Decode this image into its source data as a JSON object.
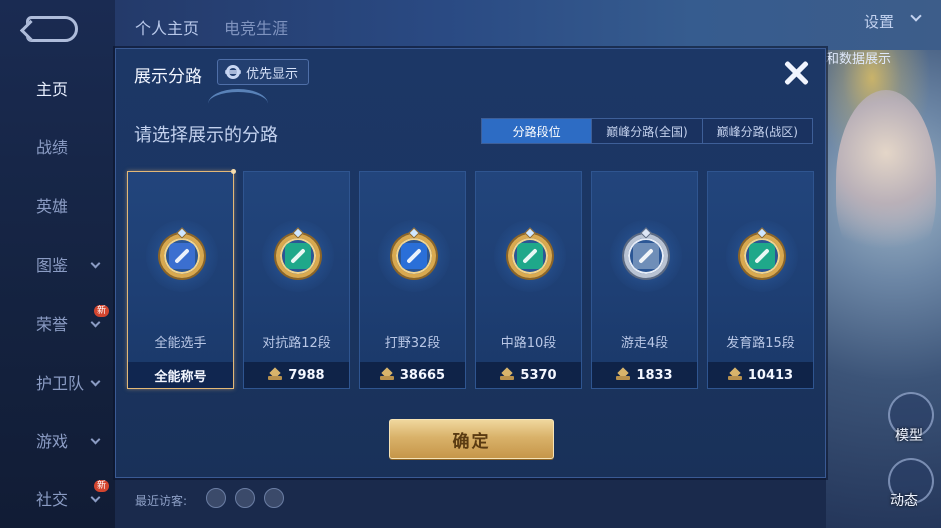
{
  "background": {
    "nav_items": [
      {
        "label": "主页",
        "active": true,
        "has_chevron": false,
        "new": false
      },
      {
        "label": "战绩",
        "active": false,
        "has_chevron": false,
        "new": false
      },
      {
        "label": "英雄",
        "active": false,
        "has_chevron": false,
        "new": false
      },
      {
        "label": "图鉴",
        "active": false,
        "has_chevron": true,
        "new": false
      },
      {
        "label": "荣誉",
        "active": false,
        "has_chevron": true,
        "new": true
      },
      {
        "label": "护卫队",
        "active": false,
        "has_chevron": true,
        "new": false
      },
      {
        "label": "游戏",
        "active": false,
        "has_chevron": true,
        "new": false
      },
      {
        "label": "社交",
        "active": false,
        "has_chevron": true,
        "new": true
      }
    ],
    "new_tag": "新",
    "top_tabs": [
      "个人主页",
      "电竞生涯"
    ],
    "settings_label": "设置",
    "corner_text": "和数据展示",
    "side_labels": [
      "模型",
      "动态"
    ],
    "recent_visitors_label": "最近访客:"
  },
  "dialog": {
    "title": "展示分路",
    "priority_button": {
      "label": "优先显示",
      "icon": "gear-icon"
    },
    "close_icon": "close-icon",
    "subtitle": "请选择展示的分路",
    "tabs": [
      {
        "label": "分路段位",
        "active": true
      },
      {
        "label": "巅峰分路(全国)",
        "active": false
      },
      {
        "label": "巅峰分路(战区)",
        "active": false
      }
    ],
    "cards": [
      {
        "name": "全能选手",
        "foot": "全能称号",
        "selected": true,
        "badge_color": "#3b6fd0",
        "badge_style": "gold",
        "show_rank_icon": false
      },
      {
        "name": "对抗路12段",
        "foot": "7988",
        "selected": false,
        "badge_color": "#1fa88a",
        "badge_style": "gold",
        "show_rank_icon": true
      },
      {
        "name": "打野32段",
        "foot": "38665",
        "selected": false,
        "badge_color": "#2a6fd8",
        "badge_style": "gold",
        "show_rank_icon": true
      },
      {
        "name": "中路10段",
        "foot": "5370",
        "selected": false,
        "badge_color": "#1fa88a",
        "badge_style": "gold",
        "show_rank_icon": true
      },
      {
        "name": "游走4段",
        "foot": "1833",
        "selected": false,
        "badge_color": "#6f8eb8",
        "badge_style": "silver",
        "show_rank_icon": true
      },
      {
        "name": "发育路15段",
        "foot": "10413",
        "selected": false,
        "badge_color": "#1fa88a",
        "badge_style": "gold",
        "show_rank_icon": true
      }
    ],
    "confirm_label": "确定"
  }
}
